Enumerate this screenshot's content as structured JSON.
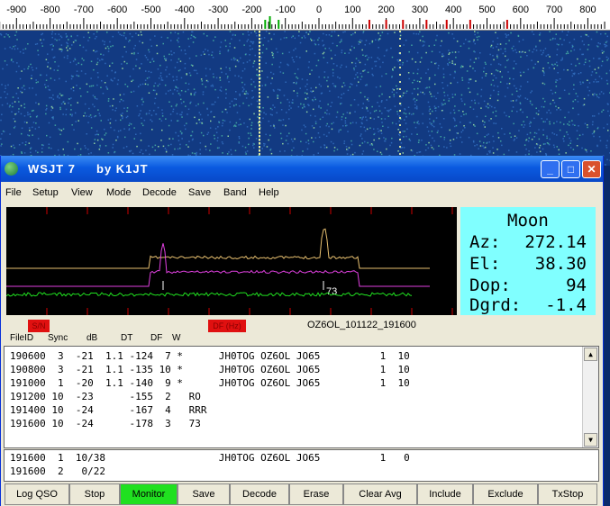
{
  "ruler": {
    "labels": [
      "-900",
      "-800",
      "-700",
      "-600",
      "-500",
      "-400",
      "-300",
      "-200",
      "-100",
      "0",
      "100",
      "200",
      "300",
      "400",
      "500",
      "600",
      "700",
      "800"
    ]
  },
  "window": {
    "title": "WSJT 7     by K1JT",
    "minimize": "_",
    "maximize": "□",
    "close": "✕"
  },
  "menu": [
    "File",
    "Setup",
    "View",
    "Mode",
    "Decode",
    "Save",
    "Band",
    "Help"
  ],
  "spectrum": {
    "tone_marker": "73"
  },
  "moon": {
    "title": "Moon",
    "az_label": "Az:",
    "az_value": "272.14",
    "el_label": "El:",
    "el_value": "38.30",
    "dop_label": "Dop:",
    "dop_value": "94",
    "dgrd_label": "Dgrd:",
    "dgrd_value": "-1.4"
  },
  "status": {
    "sync_badge": "S/N",
    "df_badge": "DF (Hz)",
    "filename": "OZ6OL_101122_191600"
  },
  "headers": [
    "FileID",
    "Sync",
    "dB",
    "DT",
    "DF",
    "W"
  ],
  "decodes": [
    "190600  3  -21  1.1 -124  7 *      JH0TOG OZ6OL JO65          1  10",
    "190800  3  -21  1.1 -135 10 *      JH0TOG OZ6OL JO65          1  10",
    "191000  1  -20  1.1 -140  9 *      JH0TOG OZ6OL JO65          1  10",
    "191200 10  -23      -155  2   RO",
    "191400 10  -24      -167  4   RRR",
    "191600 10  -24      -178  3   73"
  ],
  "averages": [
    "191600  1  10/38                   JH0TOG OZ6OL JO65          1   0",
    "191600  2   0/22"
  ],
  "buttons": [
    "Log QSO",
    "Stop",
    "Monitor",
    "Save",
    "Decode",
    "Erase",
    "Clear Avg",
    "Include",
    "Exclude",
    "TxStop"
  ],
  "colors": {
    "monitor_active": "#20e020",
    "moon_panel": "#80ffff",
    "badge": "#e01010"
  }
}
